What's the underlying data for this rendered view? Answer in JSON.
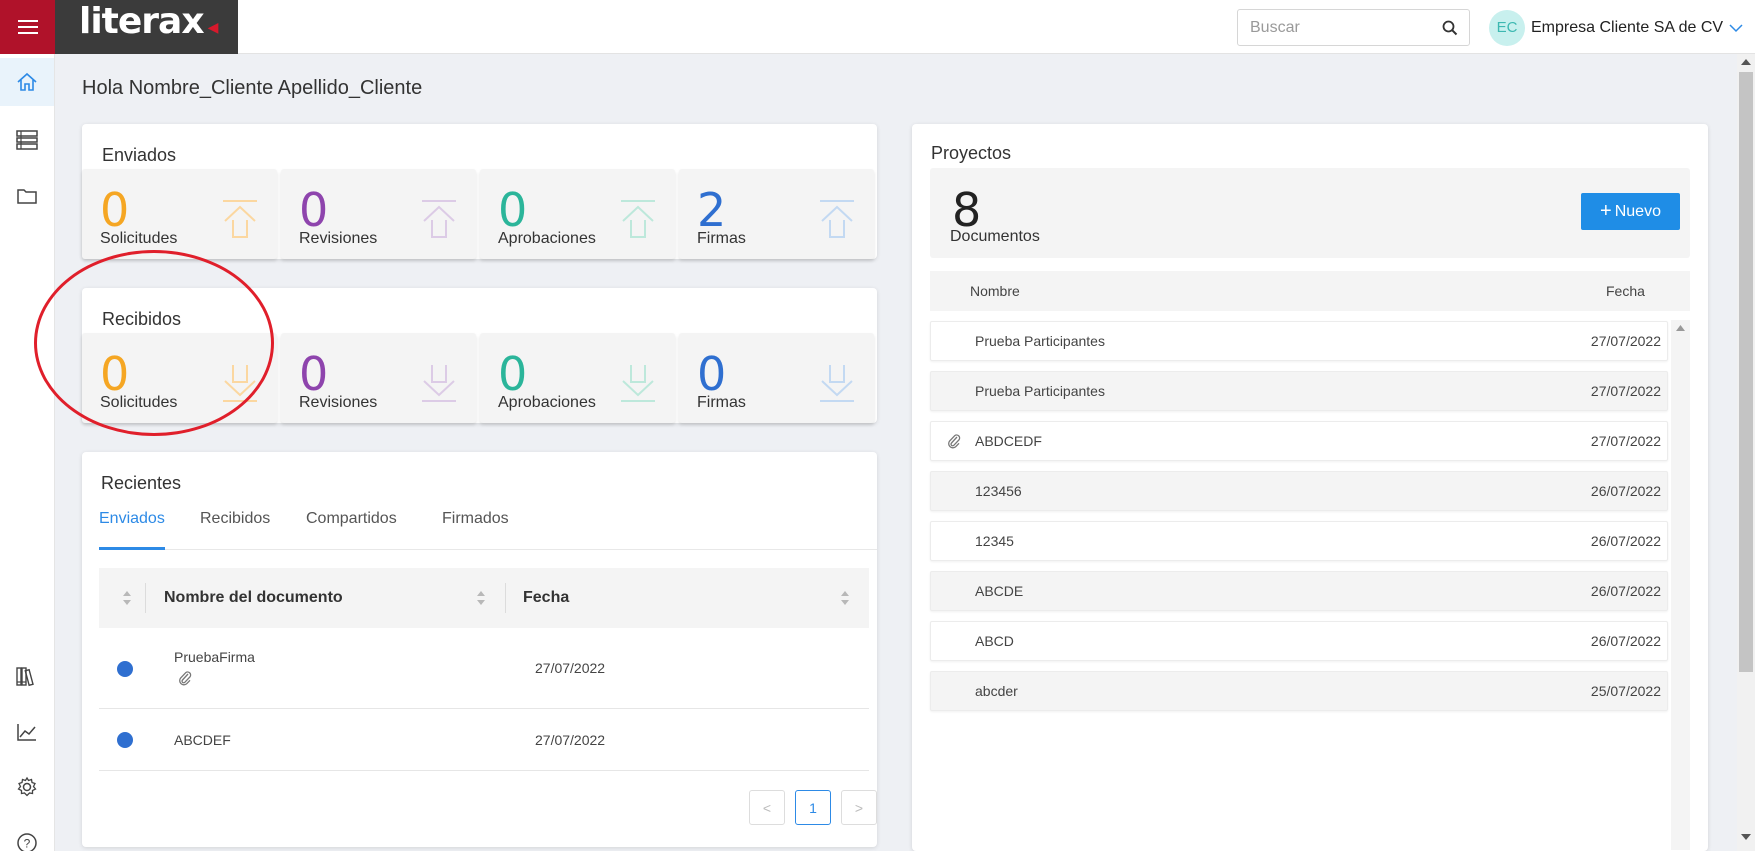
{
  "app": {
    "logo_text": "literax"
  },
  "header": {
    "search_placeholder": "Buscar",
    "avatar_initials": "EC",
    "company_name": "Empresa Cliente SA de CV"
  },
  "greeting": "Hola Nombre_Cliente Apellido_Cliente",
  "enviados": {
    "title": "Enviados",
    "stats": [
      {
        "value": "0",
        "label": "Solicitudes",
        "color": "#f5a623"
      },
      {
        "value": "0",
        "label": "Revisiones",
        "color": "#8e44ad"
      },
      {
        "value": "0",
        "label": "Aprobaciones",
        "color": "#2bb59a"
      },
      {
        "value": "2",
        "label": "Firmas",
        "color": "#2f6fd0"
      }
    ]
  },
  "recibidos": {
    "title": "Recibidos",
    "stats": [
      {
        "value": "0",
        "label": "Solicitudes",
        "color": "#f5a623"
      },
      {
        "value": "0",
        "label": "Revisiones",
        "color": "#8e44ad"
      },
      {
        "value": "0",
        "label": "Aprobaciones",
        "color": "#2bb59a"
      },
      {
        "value": "0",
        "label": "Firmas",
        "color": "#2f6fd0"
      }
    ]
  },
  "recientes": {
    "title": "Recientes",
    "tabs": [
      "Enviados",
      "Recibidos",
      "Compartidos",
      "Firmados"
    ],
    "active_tab": "Enviados",
    "columns": {
      "name": "Nombre del documento",
      "date": "Fecha"
    },
    "rows": [
      {
        "name": "PruebaFirma",
        "date": "27/07/2022",
        "has_attachment": true
      },
      {
        "name": "ABCDEF",
        "date": "27/07/2022",
        "has_attachment": false
      }
    ],
    "pagination": {
      "current_page": "1",
      "prev": "<",
      "next": ">"
    }
  },
  "proyectos": {
    "title": "Proyectos",
    "count": "8",
    "count_label": "Documentos",
    "new_button": "Nuevo",
    "columns": {
      "name": "Nombre",
      "date": "Fecha"
    },
    "rows": [
      {
        "name": "Prueba Participantes",
        "date": "27/07/2022",
        "attachment": false
      },
      {
        "name": "Prueba Participantes",
        "date": "27/07/2022",
        "attachment": false
      },
      {
        "name": "ABDCEDF",
        "date": "27/07/2022",
        "attachment": true
      },
      {
        "name": "123456",
        "date": "26/07/2022",
        "attachment": false
      },
      {
        "name": "12345",
        "date": "26/07/2022",
        "attachment": false
      },
      {
        "name": "ABCDE",
        "date": "26/07/2022",
        "attachment": false
      },
      {
        "name": "ABCD",
        "date": "26/07/2022",
        "attachment": false
      },
      {
        "name": "abcder",
        "date": "25/07/2022",
        "attachment": false
      }
    ]
  },
  "colors": {
    "brand_red": "#b0122a",
    "accent_blue": "#1f8de6",
    "annotation_red": "#e01f2b"
  }
}
